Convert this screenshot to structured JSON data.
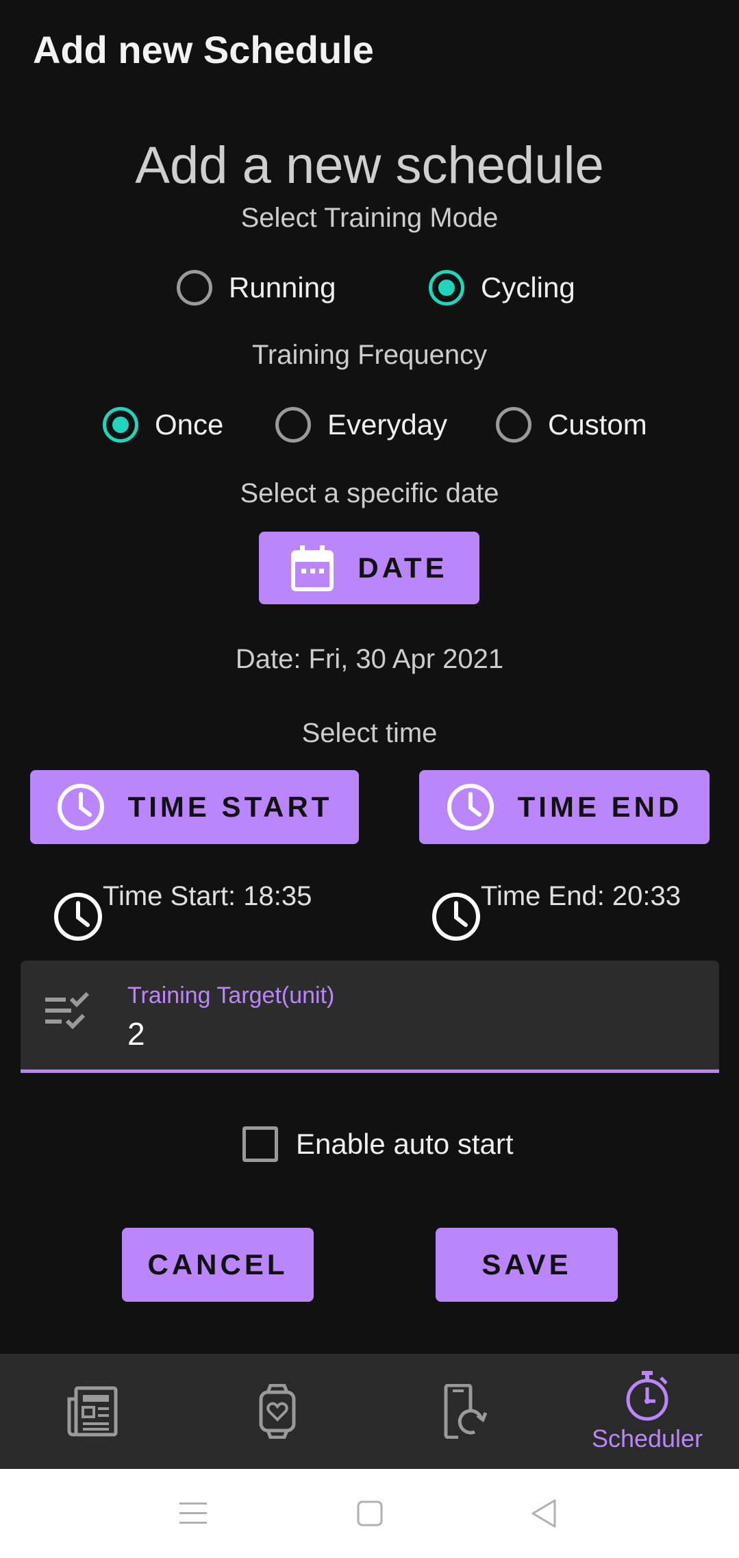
{
  "app_bar": {
    "title": "Add new Schedule"
  },
  "form": {
    "heading": "Add a new schedule",
    "mode_label": "Select Training Mode",
    "modes": [
      {
        "label": "Running",
        "selected": false
      },
      {
        "label": "Cycling",
        "selected": true
      }
    ],
    "frequency_label": "Training Frequency",
    "frequencies": [
      {
        "label": "Once",
        "selected": true
      },
      {
        "label": "Everyday",
        "selected": false
      },
      {
        "label": "Custom",
        "selected": false
      }
    ],
    "date_prompt": "Select a specific date",
    "date_button": "DATE",
    "date_value": "Date: Fri, 30 Apr 2021",
    "time_prompt": "Select time",
    "time_start_button": "TIME START",
    "time_end_button": "TIME END",
    "time_start_value": "Time Start: 18:35",
    "time_end_value": "Time End: 20:33",
    "target_label": "Training Target(unit)",
    "target_value": "2",
    "auto_start_label": "Enable auto start",
    "auto_start_checked": false,
    "cancel_button": "CANCEL",
    "save_button": "SAVE"
  },
  "bottom_nav": {
    "items": [
      {
        "icon": "newspaper-icon",
        "label": ""
      },
      {
        "icon": "smartwatch-heart-icon",
        "label": ""
      },
      {
        "icon": "phone-refresh-icon",
        "label": ""
      },
      {
        "icon": "stopwatch-icon",
        "label": "Scheduler",
        "active": true
      }
    ]
  },
  "system_nav": {
    "icons": [
      "menu-icon",
      "home-square-icon",
      "back-triangle-icon"
    ]
  },
  "colors": {
    "background": "#121112",
    "accent": "#bb86fc",
    "radio_selected": "#1fd6bc",
    "surface": "#2d2c2d"
  }
}
